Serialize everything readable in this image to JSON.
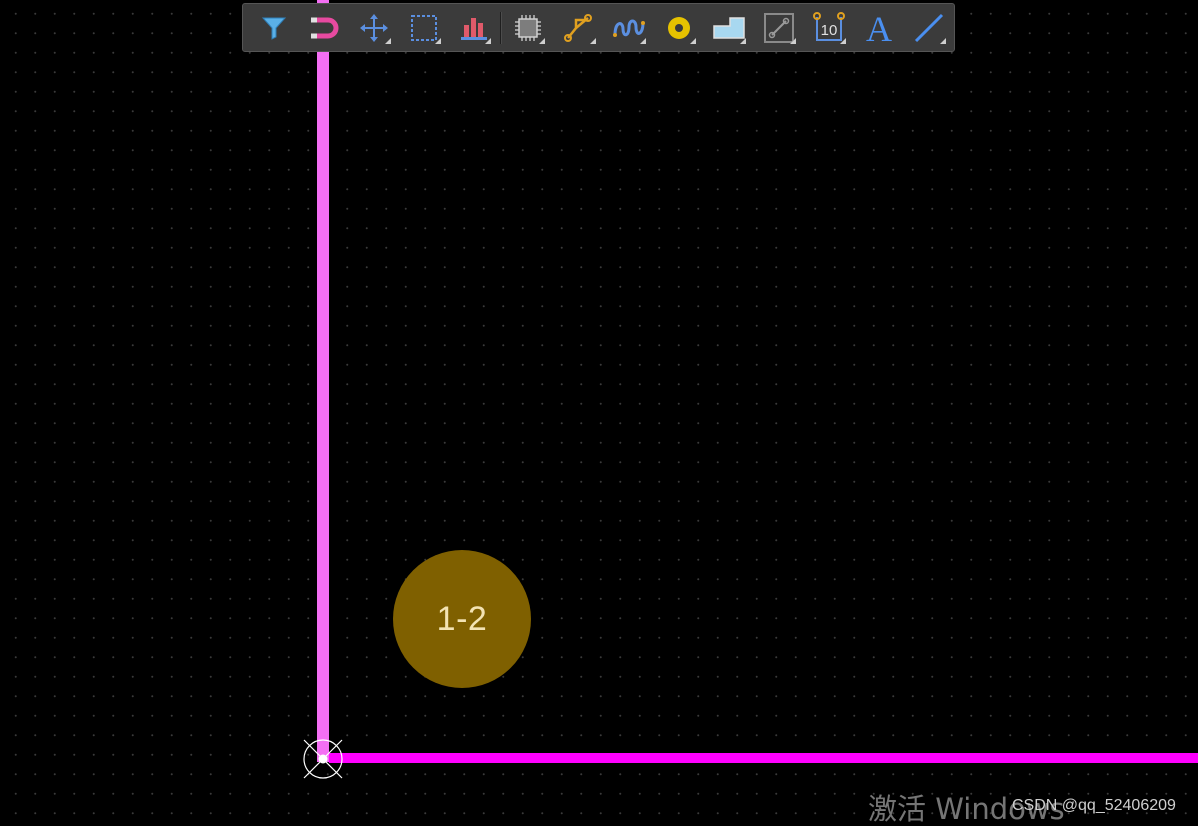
{
  "toolbar": {
    "tools": [
      {
        "icon": "filter-icon",
        "has_dropdown": false
      },
      {
        "icon": "magnet-icon",
        "has_dropdown": false
      },
      {
        "icon": "move-icon",
        "has_dropdown": true
      },
      {
        "icon": "selection-rectangle-icon",
        "has_dropdown": true
      },
      {
        "icon": "align-icon",
        "has_dropdown": true
      },
      {
        "icon": "component-icon",
        "has_dropdown": true
      },
      {
        "icon": "route-icon",
        "has_dropdown": true
      },
      {
        "icon": "length-tune-icon",
        "has_dropdown": true
      },
      {
        "icon": "via-icon",
        "has_dropdown": true
      },
      {
        "icon": "polygon-pour-icon",
        "has_dropdown": true
      },
      {
        "icon": "keepout-icon",
        "has_dropdown": true
      },
      {
        "icon": "dimension-icon",
        "has_dropdown": true
      },
      {
        "icon": "text-icon",
        "has_dropdown": false
      },
      {
        "icon": "line-icon",
        "has_dropdown": true
      }
    ],
    "dimension_label": "10",
    "text_glyph": "A"
  },
  "canvas": {
    "pad_label": "1-2",
    "colors": {
      "background": "#000000",
      "trace_vertical": "#f46ff4",
      "trace_horizontal": "#ff00ff",
      "pad": "#7f6000",
      "pad_text": "#f3e3b3"
    }
  },
  "overlay": {
    "activation_watermark": "激活 Windows",
    "csdn_credit": "CSDN @qq_52406209"
  }
}
